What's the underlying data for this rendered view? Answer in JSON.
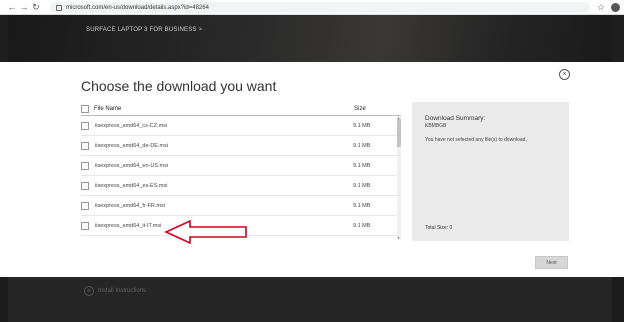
{
  "browser": {
    "back_icon": "←",
    "forward_icon": "→",
    "reload_icon": "↻",
    "url": "microsoft.com/en-us/download/details.aspx?id=48264",
    "star_icon": "☆"
  },
  "hero": {
    "link_text": "SURFACE LAPTOP 3 FOR BUSINESS >"
  },
  "dialog": {
    "title": "Choose the download you want",
    "close_icon": "×",
    "list": {
      "header_file": "File Name",
      "header_size": "Size",
      "rows": [
        {
          "name": "iisexpress_amd64_cs-CZ.msi",
          "size": "9.1 MB"
        },
        {
          "name": "iisexpress_amd64_de-DE.msi",
          "size": "9.1 MB"
        },
        {
          "name": "iisexpress_amd64_en-US.msi",
          "size": "9.1 MB"
        },
        {
          "name": "iisexpress_amd64_es-ES.msi",
          "size": "9.1 MB"
        },
        {
          "name": "iisexpress_amd64_fr-FR.msi",
          "size": "9.1 MB"
        },
        {
          "name": "iisexpress_amd64_it-IT.msi",
          "size": "9.1 MB"
        }
      ]
    },
    "summary": {
      "title": "Download Summary:",
      "size": "KBMBGB",
      "message": "You have not selected any file(s) to download.",
      "total": "Total Size: 0"
    },
    "next_label": "Next"
  },
  "footer": {
    "plus_icon": "+",
    "item_label": "Install Instructions"
  },
  "colors": {
    "arrow": "#d0021b",
    "hero_bg": "#1e1e1e",
    "summary_bg": "#eaeaea"
  }
}
